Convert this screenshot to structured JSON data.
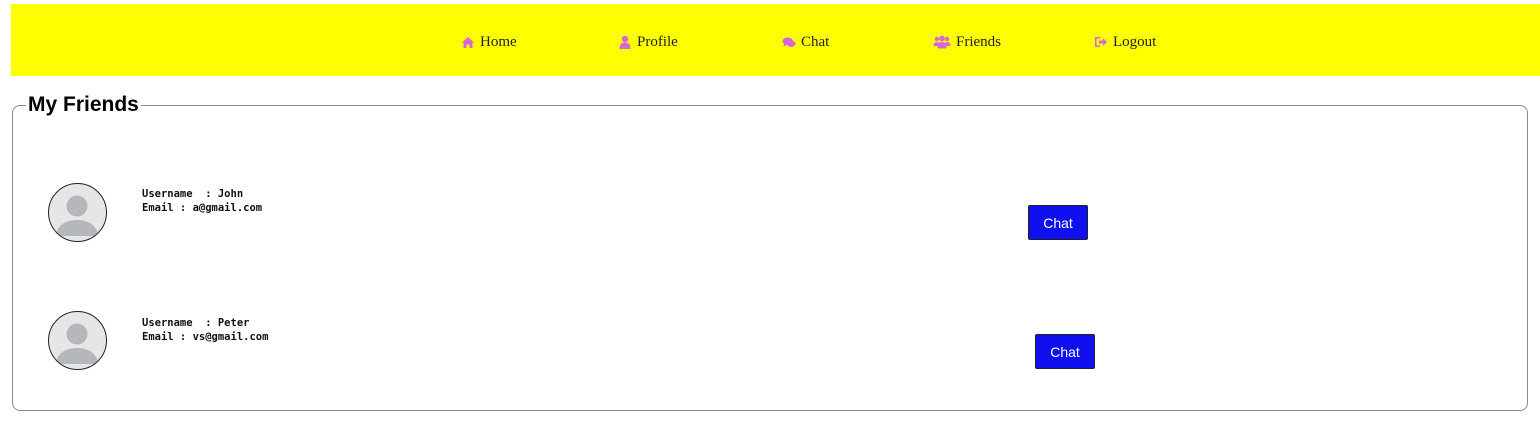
{
  "nav": {
    "items": [
      {
        "label": "Home",
        "icon": "home-icon"
      },
      {
        "label": "Profile",
        "icon": "user-icon"
      },
      {
        "label": "Chat",
        "icon": "comments-icon"
      },
      {
        "label": "Friends",
        "icon": "users-icon"
      },
      {
        "label": "Logout",
        "icon": "sign-out-icon"
      }
    ],
    "background_color": "#ffff00",
    "icon_color": "#d966d6"
  },
  "friends": {
    "title": "My Friends",
    "list": [
      {
        "username_line": "Username  : John",
        "email_line": "Email : a@gmail.com",
        "chat_label": "Chat"
      },
      {
        "username_line": "Username  : Peter",
        "email_line": "Email : vs@gmail.com",
        "chat_label": "Chat"
      }
    ]
  },
  "colors": {
    "chat_button": "#1010ee"
  }
}
